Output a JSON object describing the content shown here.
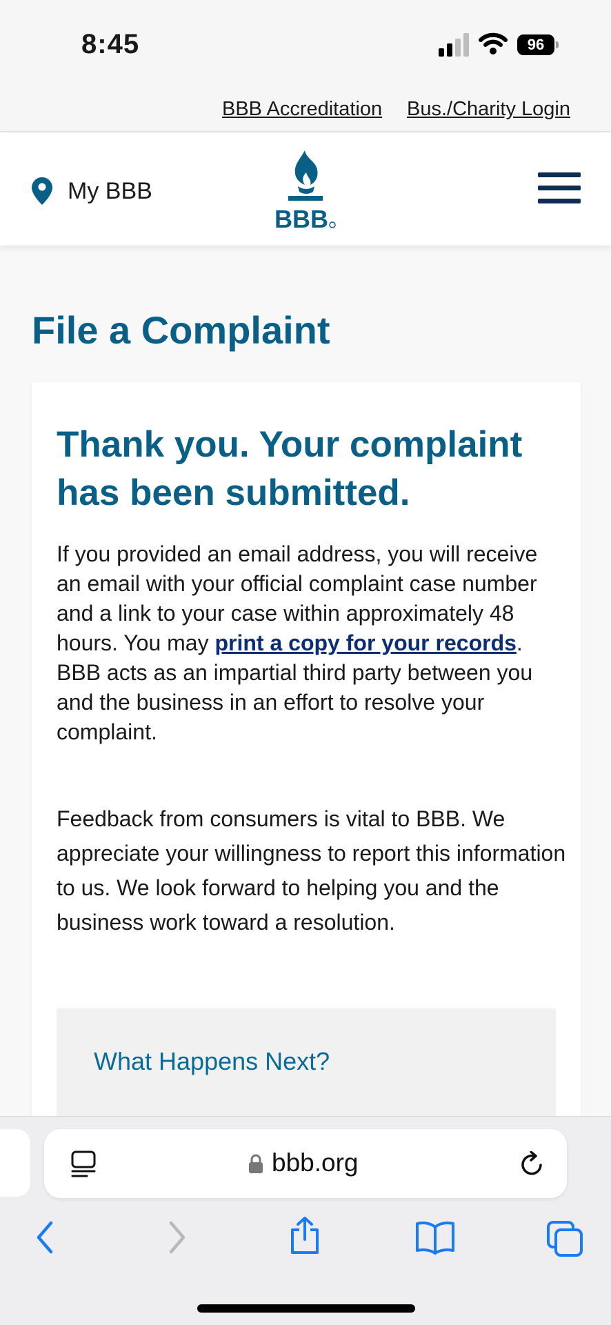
{
  "status_bar": {
    "time": "8:45",
    "battery": "96"
  },
  "utility_nav": {
    "accreditation": "BBB Accreditation",
    "login": "Bus./Charity Login"
  },
  "header": {
    "location_label": "My BBB",
    "logo_text": "BBB"
  },
  "page": {
    "title": "File a Complaint"
  },
  "confirmation": {
    "heading": "Thank you. Your complaint has been submitted.",
    "para1_before": "If you provided an email address, you will receive an email with your official complaint case number and a link to your case within approximately 48 hours. You may ",
    "print_link": "print a copy for your records",
    "para1_after": ". BBB acts as an impartial third party between you and the business in an effort to resolve your complaint.",
    "para2": "Feedback from consumers is vital to BBB. We appreciate your willingness to report this information to us. We look forward to helping you and the business work toward a resolution.",
    "next_heading": "What Happens Next?"
  },
  "browser": {
    "url": "bbb.org"
  },
  "colors": {
    "brand_teal": "#0a5f86",
    "brand_navy": "#0d2d52",
    "link_navy": "#0d2d72",
    "ios_blue": "#1a7cf5"
  },
  "icons": [
    "location-pin-icon",
    "bbb-torch-logo",
    "hamburger-menu-icon",
    "reader-mode-icon",
    "lock-icon",
    "reload-icon",
    "back-icon",
    "forward-icon",
    "share-icon",
    "bookmarks-icon",
    "tabs-icon"
  ]
}
